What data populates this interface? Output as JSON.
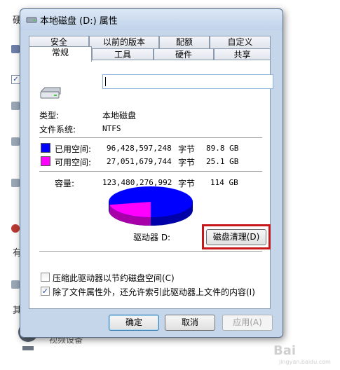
{
  "dialog": {
    "title": "本地磁盘 (D:) 属性",
    "tabs_top": [
      "安全",
      "以前的版本",
      "配额",
      "自定义"
    ],
    "tabs_bottom": [
      "常规",
      "工具",
      "硬件",
      "共享"
    ],
    "active_tab": "常规"
  },
  "general": {
    "name_value": "",
    "type_label": "类型:",
    "type_value": "本地磁盘",
    "fs_label": "文件系统:",
    "fs_value": "NTFS",
    "used": {
      "label": "已用空间:",
      "bytes": "96,428,597,248",
      "unit": "字节",
      "size": "89.8 GB",
      "color": "#0000ff"
    },
    "free": {
      "label": "可用空间:",
      "bytes": "27,051,679,744",
      "unit": "字节",
      "size": "25.1 GB",
      "color": "#ff00ff"
    },
    "capacity": {
      "label": "容量:",
      "bytes": "123,480,276,992",
      "unit": "字节",
      "size": "114 GB"
    },
    "drive_label": "驱动器 D:",
    "cleanup_button": "磁盘清理(D)",
    "compress_label": "压缩此驱动器以节约磁盘空间(C)",
    "compress_checked": false,
    "index_label": "除了文件属性外，还允许索引此驱动器上文件的内容(I)",
    "index_checked": true
  },
  "pie": {
    "used_fraction": 0.781,
    "free_fraction": 0.219
  },
  "buttons": {
    "ok": "确定",
    "cancel": "取消",
    "apply": "应用(A)"
  },
  "background": {
    "left_char_1": "硬",
    "left_char_2": "有",
    "left_char_3": "其",
    "bottom_text": "视频设备"
  },
  "watermark": {
    "brand": "Bai",
    "sub": "jingyan.baidu.com"
  },
  "accent_colors": {
    "highlight": "#c8171c",
    "used": "#0000ff",
    "free": "#ff00ff"
  }
}
